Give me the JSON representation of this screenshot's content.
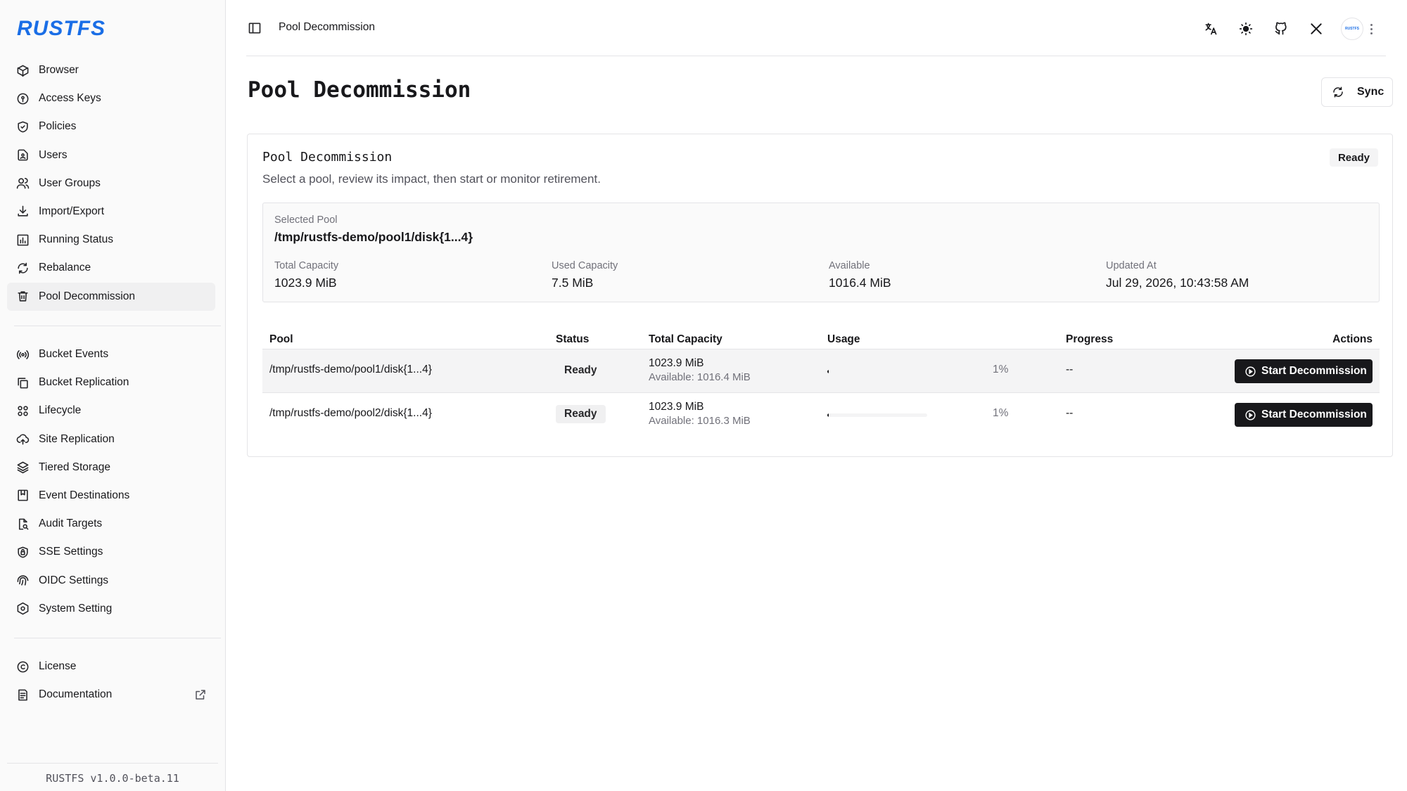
{
  "app": {
    "logo": "RUSTFS",
    "version": "RUSTFS v1.0.0-beta.11"
  },
  "sidebar": {
    "group1": [
      {
        "label": "Browser",
        "icon": "cube-icon"
      },
      {
        "label": "Access Keys",
        "icon": "key-circle-icon"
      },
      {
        "label": "Policies",
        "icon": "shield-check-icon"
      },
      {
        "label": "Users",
        "icon": "user-file-icon"
      },
      {
        "label": "User Groups",
        "icon": "users-icon"
      },
      {
        "label": "Import/Export",
        "icon": "download-icon"
      },
      {
        "label": "Running Status",
        "icon": "bar-chart-icon"
      },
      {
        "label": "Rebalance",
        "icon": "refresh-icon"
      },
      {
        "label": "Pool Decommission",
        "icon": "trash-icon",
        "active": true
      }
    ],
    "group2": [
      {
        "label": "Bucket Events",
        "icon": "broadcast-icon"
      },
      {
        "label": "Bucket Replication",
        "icon": "copy-icon"
      },
      {
        "label": "Lifecycle",
        "icon": "lifecycle-icon"
      },
      {
        "label": "Site Replication",
        "icon": "cloud-upload-icon"
      },
      {
        "label": "Tiered Storage",
        "icon": "layers-icon"
      },
      {
        "label": "Event Destinations",
        "icon": "bookmark-icon"
      },
      {
        "label": "Audit Targets",
        "icon": "file-search-icon"
      },
      {
        "label": "SSE Settings",
        "icon": "shield-lock-icon"
      },
      {
        "label": "OIDC Settings",
        "icon": "fingerprint-icon"
      },
      {
        "label": "System Setting",
        "icon": "hexagon-settings-icon"
      }
    ],
    "group3": [
      {
        "label": "License",
        "icon": "copyright-icon"
      },
      {
        "label": "Documentation",
        "icon": "doc-icon"
      }
    ]
  },
  "header": {
    "breadcrumb": "Pool Decommission",
    "avatar_text": "RUSTFS"
  },
  "page": {
    "title": "Pool Decommission",
    "sync_label": "Sync"
  },
  "card": {
    "title": "Pool Decommission",
    "description": "Select a pool, review its impact, then start or monitor retirement.",
    "status": "Ready",
    "selected_pool_label": "Selected Pool",
    "selected_pool": "/tmp/rustfs-demo/pool1/disk{1...4}",
    "total_capacity_label": "Total Capacity",
    "total_capacity": "1023.9 MiB",
    "used_capacity_label": "Used Capacity",
    "used_capacity": "7.5 MiB",
    "available_label": "Available",
    "available": "1016.4 MiB",
    "updated_at_label": "Updated At",
    "updated_at": "Jul 29, 2026, 10:43:58 AM"
  },
  "table": {
    "headers": {
      "pool": "Pool",
      "status": "Status",
      "total_capacity": "Total Capacity",
      "usage": "Usage",
      "progress": "Progress",
      "actions": "Actions"
    },
    "rows": [
      {
        "pool": "/tmp/rustfs-demo/pool1/disk{1...4}",
        "status": "Ready",
        "capacity": "1023.9 MiB",
        "available": "Available: 1016.4 MiB",
        "usage_pct": "1%",
        "usage_fraction": 0.01,
        "progress": "--",
        "action": "Start Decommission"
      },
      {
        "pool": "/tmp/rustfs-demo/pool2/disk{1...4}",
        "status": "Ready",
        "capacity": "1023.9 MiB",
        "available": "Available: 1016.3 MiB",
        "usage_pct": "1%",
        "usage_fraction": 0.01,
        "progress": "--",
        "action": "Start Decommission"
      }
    ]
  }
}
